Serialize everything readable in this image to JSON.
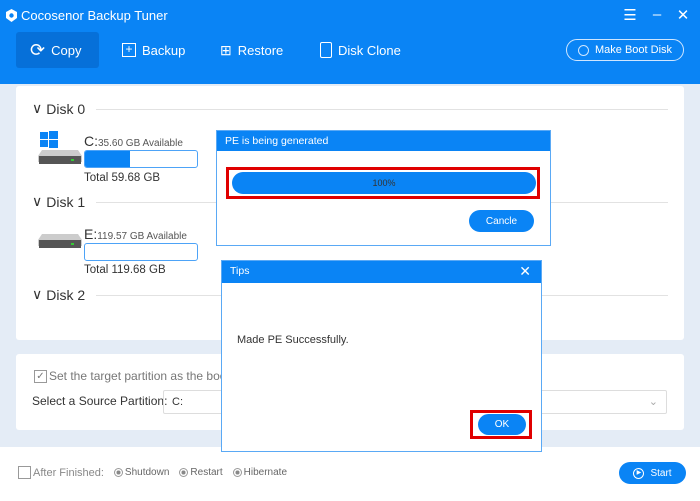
{
  "app": {
    "title": "Cocosenor Backup Tuner"
  },
  "nav": [
    {
      "label": "Copy",
      "icon": "sync-icon",
      "active": true
    },
    {
      "label": "Backup",
      "icon": "backup-plus-icon"
    },
    {
      "label": "Restore",
      "icon": "restore-icon"
    },
    {
      "label": "Disk Clone",
      "icon": "disk-clone-icon"
    }
  ],
  "make_boot_disk": "Make Boot Disk",
  "disks": [
    {
      "name": "Disk 0",
      "letter": "C:",
      "available": "35.60 GB Available",
      "total": "Total 59.68 GB",
      "used_fraction": 0.4,
      "windows": true
    },
    {
      "name": "Disk 1",
      "letter": "E:",
      "available": "119.57 GB Available",
      "total": "Total 119.68 GB",
      "used_fraction": 0.0
    },
    {
      "name": "Disk 2"
    }
  ],
  "options": {
    "set_boot_label": "Set the target partition as the boot",
    "source_label": "Select a Source Partition:",
    "source_value": "C:"
  },
  "footer": {
    "after_finished": "After Finished:",
    "radios": [
      "Shutdown",
      "Restart",
      "Hibernate"
    ],
    "start": "Start"
  },
  "pe_dialog": {
    "title": "PE is being generated",
    "progress_text": "100%",
    "progress": 100,
    "cancel": "Cancle"
  },
  "tips_dialog": {
    "title": "Tips",
    "message": "Made PE Successfully.",
    "ok": "OK"
  },
  "colors": {
    "accent": "#0a84f5",
    "highlight": "#e00000"
  }
}
